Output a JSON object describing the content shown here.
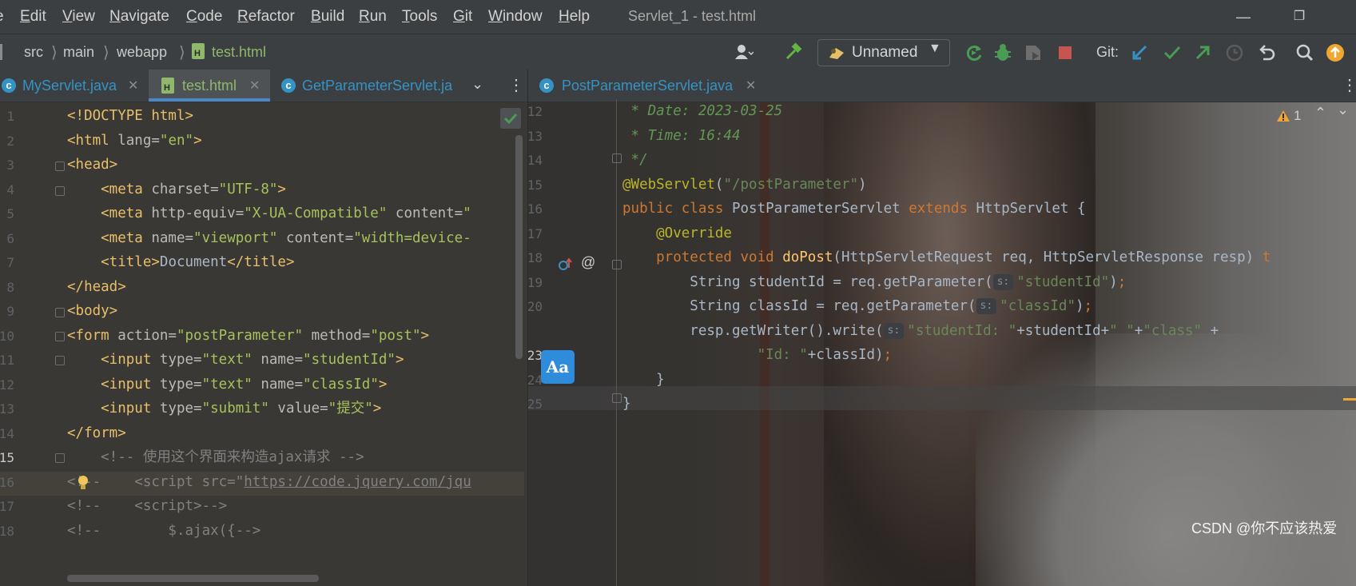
{
  "menu": {
    "items": [
      {
        "label": "e",
        "u": ""
      },
      {
        "label": "dit",
        "u": "E"
      },
      {
        "label": "iew",
        "u": "V"
      },
      {
        "label": "avigate",
        "u": "N"
      },
      {
        "label": "ode",
        "u": "C"
      },
      {
        "label": "efactor",
        "u": "R"
      },
      {
        "label": "uild",
        "u": "B"
      },
      {
        "label": "un",
        "u": "R"
      },
      {
        "label": "ools",
        "u": "T"
      },
      {
        "label": "it",
        "u": "G"
      },
      {
        "label": "indow",
        "u": "W"
      },
      {
        "label": "elp",
        "u": "H"
      }
    ],
    "window_title": "Servlet_1 - test.html"
  },
  "breadcrumb": {
    "items": [
      "src",
      "main",
      "webapp",
      "test.html"
    ]
  },
  "toolbar": {
    "run_config": "Unnamed",
    "git_label": "Git:"
  },
  "left_tabs": [
    {
      "label": "MyServlet.java",
      "active": false
    },
    {
      "label": "test.html",
      "active": true
    },
    {
      "label": "GetParameterServlet.ja",
      "active": false
    }
  ],
  "right_tabs": [
    {
      "label": "PostParameterServlet.java",
      "active": true
    }
  ],
  "left_editor": {
    "line_numbers": [
      "1",
      "2",
      "3",
      "4",
      "5",
      "6",
      "7",
      "8",
      "9",
      "10",
      "11",
      "12",
      "13",
      "14",
      "15",
      "16",
      "17",
      "18"
    ],
    "lines": [
      [
        {
          "c": "tag",
          "t": "<!DOCTYPE html>"
        }
      ],
      [
        {
          "c": "tag",
          "t": "<html "
        },
        {
          "c": "attr",
          "t": "lang="
        },
        {
          "c": "val",
          "t": "\"en\""
        },
        {
          "c": "tag",
          "t": ">"
        }
      ],
      [
        {
          "c": "tag",
          "t": "<head>"
        }
      ],
      [
        {
          "c": "tag",
          "t": "    <meta "
        },
        {
          "c": "attr",
          "t": "charset="
        },
        {
          "c": "val",
          "t": "\"UTF-8\""
        },
        {
          "c": "tag",
          "t": ">"
        }
      ],
      [
        {
          "c": "tag",
          "t": "    <meta "
        },
        {
          "c": "attr",
          "t": "http-equiv="
        },
        {
          "c": "val",
          "t": "\"X-UA-Compatible\""
        },
        {
          "c": "attr",
          "t": " content="
        },
        {
          "c": "val",
          "t": "\""
        }
      ],
      [
        {
          "c": "tag",
          "t": "    <meta "
        },
        {
          "c": "attr",
          "t": "name="
        },
        {
          "c": "val",
          "t": "\"viewport\""
        },
        {
          "c": "attr",
          "t": " content="
        },
        {
          "c": "val",
          "t": "\"width=device-"
        }
      ],
      [
        {
          "c": "tag",
          "t": "    <title>"
        },
        {
          "c": "txt",
          "t": "Document"
        },
        {
          "c": "tag",
          "t": "</title>"
        }
      ],
      [
        {
          "c": "tag",
          "t": "</head>"
        }
      ],
      [
        {
          "c": "tag",
          "t": "<body>"
        }
      ],
      [
        {
          "c": "tag",
          "t": "<form "
        },
        {
          "c": "attr",
          "t": "action="
        },
        {
          "c": "val",
          "t": "\"postParameter\""
        },
        {
          "c": "attr",
          "t": " method="
        },
        {
          "c": "val",
          "t": "\"post\""
        },
        {
          "c": "tag",
          "t": ">"
        }
      ],
      [
        {
          "c": "tag",
          "t": "    <input "
        },
        {
          "c": "attr",
          "t": "type="
        },
        {
          "c": "val",
          "t": "\"text\""
        },
        {
          "c": "attr",
          "t": " name="
        },
        {
          "c": "val",
          "t": "\"studentId\""
        },
        {
          "c": "tag",
          "t": ">"
        }
      ],
      [
        {
          "c": "tag",
          "t": "    <input "
        },
        {
          "c": "attr",
          "t": "type="
        },
        {
          "c": "val",
          "t": "\"text\""
        },
        {
          "c": "attr",
          "t": " name="
        },
        {
          "c": "val",
          "t": "\"classId\""
        },
        {
          "c": "tag",
          "t": ">"
        }
      ],
      [
        {
          "c": "tag",
          "t": "    <input "
        },
        {
          "c": "attr",
          "t": "type="
        },
        {
          "c": "val",
          "t": "\"submit\""
        },
        {
          "c": "attr",
          "t": " value="
        },
        {
          "c": "val",
          "t": "\"提交\""
        },
        {
          "c": "tag",
          "t": ">"
        }
      ],
      [
        {
          "c": "tag",
          "t": "</form>"
        }
      ],
      [
        {
          "c": "cmt",
          "t": "    <!-- 使用这个界面来构造ajax请求 -->"
        }
      ],
      [
        {
          "c": "cmt",
          "t": "<!--    <script src=\""
        },
        {
          "c": "cmt u",
          "t": "https://code.jquery.com/jqu"
        }
      ],
      [
        {
          "c": "cmt",
          "t": "<!--    <script>-->"
        }
      ],
      [
        {
          "c": "cmt",
          "t": "<!--        $.ajax({-->"
        }
      ]
    ]
  },
  "right_editor": {
    "line_numbers": [
      "12",
      "13",
      "14",
      "15",
      "16",
      "17",
      "18",
      "19",
      "20",
      "",
      "23",
      "24",
      "25"
    ],
    "warning_count": "1",
    "lines": [
      [
        {
          "c": "doc",
          "t": " * Date: 2023-03-25"
        }
      ],
      [
        {
          "c": "doc",
          "t": " * Time: 16:44"
        }
      ],
      [
        {
          "c": "doc",
          "t": " */"
        }
      ],
      [
        {
          "c": "ann",
          "t": "@WebServlet"
        },
        {
          "c": "txt",
          "t": "("
        },
        {
          "c": "str",
          "t": "\"/postParameter\""
        },
        {
          "c": "txt",
          "t": ")"
        }
      ],
      [
        {
          "c": "kw",
          "t": "public class "
        },
        {
          "c": "txt",
          "t": "PostParameterServlet "
        },
        {
          "c": "kw",
          "t": "extends "
        },
        {
          "c": "txt",
          "t": "HttpServlet {"
        }
      ],
      [
        {
          "c": "ann",
          "t": "    @Override"
        }
      ],
      [
        {
          "c": "kw",
          "t": "    protected void "
        },
        {
          "c": "fn",
          "t": "doPost"
        },
        {
          "c": "txt",
          "t": "(HttpServletRequest req, HttpServletResponse resp) "
        },
        {
          "c": "kw",
          "t": "t"
        }
      ],
      [
        {
          "c": "txt",
          "t": "        String studentId = req.getParameter("
        },
        {
          "c": "hint",
          "t": "s:"
        },
        {
          "c": "str",
          "t": "\"studentId\""
        },
        {
          "c": "txt",
          "t": ")"
        },
        {
          "c": "kw",
          "t": ";"
        }
      ],
      [
        {
          "c": "txt",
          "t": "        String classId = req.getParameter("
        },
        {
          "c": "hint",
          "t": "s:"
        },
        {
          "c": "str",
          "t": "\"classId\""
        },
        {
          "c": "txt",
          "t": ")"
        },
        {
          "c": "kw",
          "t": ";"
        }
      ],
      [
        {
          "c": "txt",
          "t": "        resp.getWriter().write("
        },
        {
          "c": "hint",
          "t": "s:"
        },
        {
          "c": "str",
          "t": "\"studentId: \""
        },
        {
          "c": "txt",
          "t": "+studentId+"
        },
        {
          "c": "str",
          "t": "\" \""
        },
        {
          "c": "txt",
          "t": "+"
        },
        {
          "c": "str",
          "t": "\"class\""
        },
        {
          "c": "txt",
          "t": " +"
        }
      ],
      [
        {
          "c": "str",
          "t": "                \"Id: \""
        },
        {
          "c": "txt",
          "t": "+classId)"
        },
        {
          "c": "kw",
          "t": ";"
        }
      ],
      [
        {
          "c": "txt",
          "t": "    }"
        }
      ],
      [
        {
          "c": "txt",
          "t": "}"
        }
      ],
      [
        {
          "c": "txt",
          "t": ""
        }
      ]
    ]
  },
  "aa_button": "Aa",
  "watermark": "CSDN @你不应该热爱",
  "colors": {
    "accent": "#4a88c7",
    "active_tab_underline": "#4a88c7",
    "run_green": "#499c54",
    "stop_red": "#c75450"
  }
}
